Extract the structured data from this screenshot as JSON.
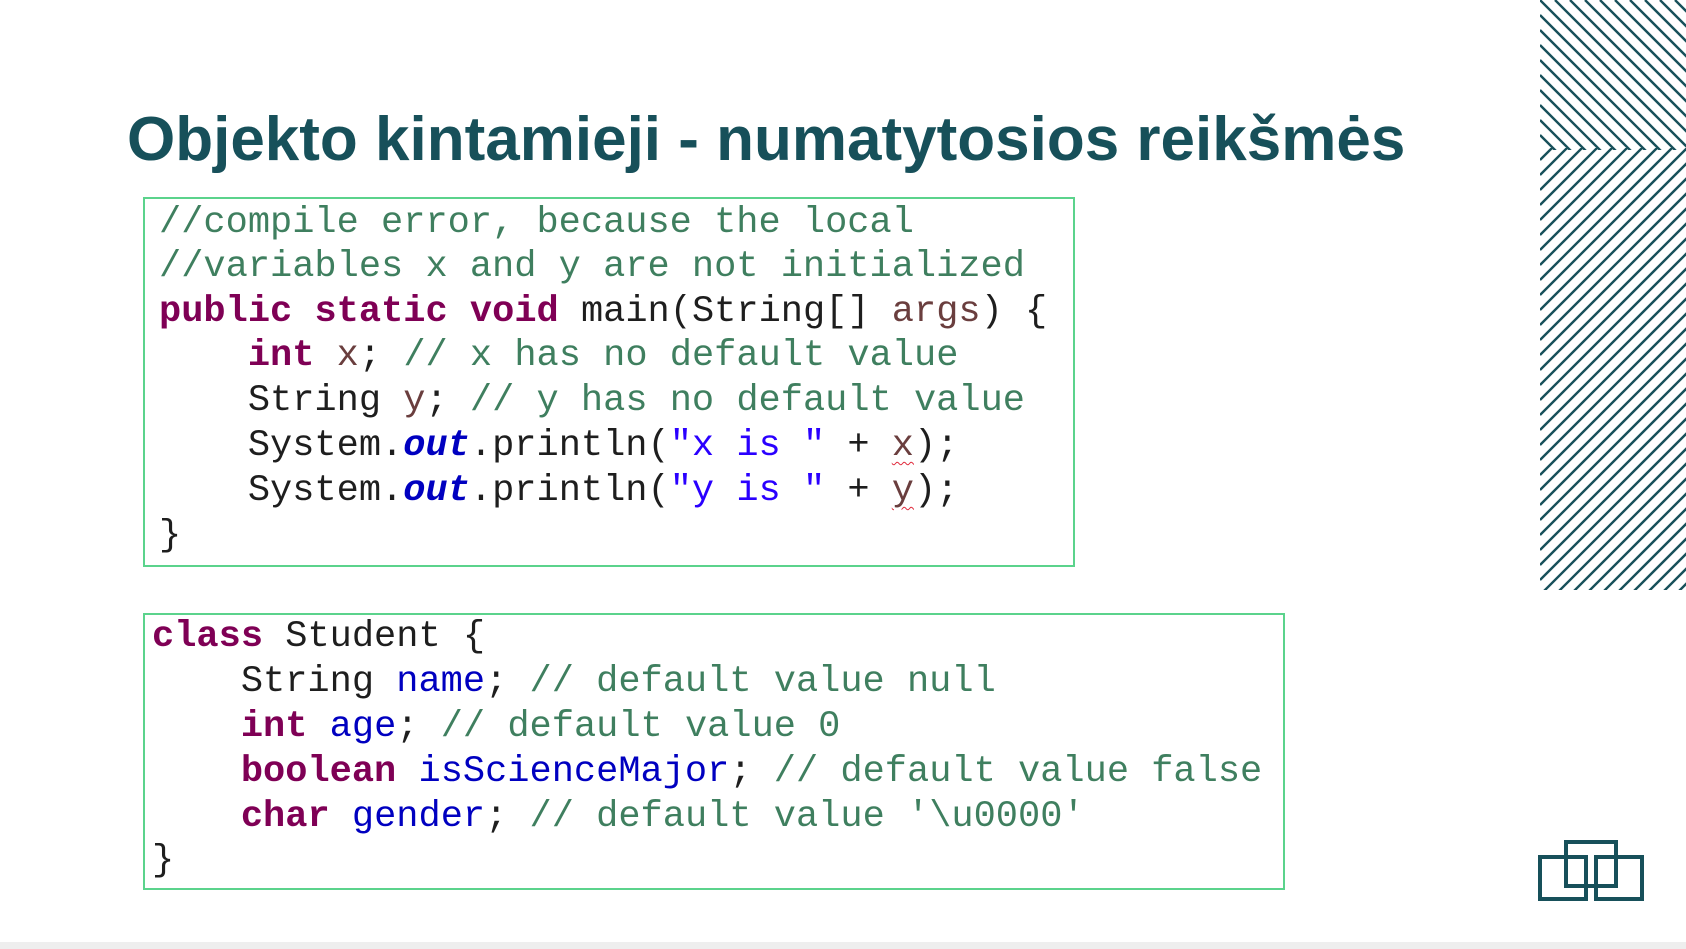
{
  "slide": {
    "title": "Objekto kintamieji - numatytosios reikšmės",
    "accent_color": "#17505a",
    "code_border_color": "#5bd38c"
  },
  "code_block_1": {
    "lines": [
      [
        {
          "t": "//compile error, because the local",
          "c": "cm"
        }
      ],
      [
        {
          "t": "//variables x and y are not initialized",
          "c": "cm"
        }
      ],
      [
        {
          "t": "public",
          "c": "kw"
        },
        {
          "t": " ",
          "c": "pln"
        },
        {
          "t": "static",
          "c": "kw"
        },
        {
          "t": " ",
          "c": "pln"
        },
        {
          "t": "void",
          "c": "kw"
        },
        {
          "t": " main(String[] ",
          "c": "pln"
        },
        {
          "t": "args",
          "c": "var"
        },
        {
          "t": ") {",
          "c": "pln"
        }
      ],
      [
        {
          "t": "    ",
          "c": "pln"
        },
        {
          "t": "int",
          "c": "kw"
        },
        {
          "t": " ",
          "c": "pln"
        },
        {
          "t": "x",
          "c": "var"
        },
        {
          "t": "; ",
          "c": "pln"
        },
        {
          "t": "// x has no default value",
          "c": "cm"
        }
      ],
      [
        {
          "t": "    String ",
          "c": "pln"
        },
        {
          "t": "y",
          "c": "var"
        },
        {
          "t": "; ",
          "c": "pln"
        },
        {
          "t": "// y has no default value",
          "c": "cm"
        }
      ],
      [
        {
          "t": "    System.",
          "c": "pln"
        },
        {
          "t": "out",
          "c": "stf"
        },
        {
          "t": ".println(",
          "c": "pln"
        },
        {
          "t": "\"x is \"",
          "c": "str"
        },
        {
          "t": " + ",
          "c": "pln"
        },
        {
          "t": "x",
          "c": "err"
        },
        {
          "t": ");",
          "c": "pln"
        }
      ],
      [
        {
          "t": "    System.",
          "c": "pln"
        },
        {
          "t": "out",
          "c": "stf"
        },
        {
          "t": ".println(",
          "c": "pln"
        },
        {
          "t": "\"y is \"",
          "c": "str"
        },
        {
          "t": " + ",
          "c": "pln"
        },
        {
          "t": "y",
          "c": "err"
        },
        {
          "t": ");",
          "c": "pln"
        }
      ],
      [
        {
          "t": "}",
          "c": "pln"
        }
      ]
    ]
  },
  "code_block_2": {
    "lines": [
      [
        {
          "t": "class",
          "c": "kw"
        },
        {
          "t": " Student {",
          "c": "pln"
        }
      ],
      [
        {
          "t": "    String ",
          "c": "pln"
        },
        {
          "t": "name",
          "c": "fld"
        },
        {
          "t": "; ",
          "c": "pln"
        },
        {
          "t": "// default value null",
          "c": "cm"
        }
      ],
      [
        {
          "t": "    ",
          "c": "pln"
        },
        {
          "t": "int",
          "c": "kw"
        },
        {
          "t": " ",
          "c": "pln"
        },
        {
          "t": "age",
          "c": "fld"
        },
        {
          "t": "; ",
          "c": "pln"
        },
        {
          "t": "// default value 0",
          "c": "cm"
        }
      ],
      [
        {
          "t": "    ",
          "c": "pln"
        },
        {
          "t": "boolean",
          "c": "kw"
        },
        {
          "t": " ",
          "c": "pln"
        },
        {
          "t": "isScienceMajor",
          "c": "fld"
        },
        {
          "t": "; ",
          "c": "pln"
        },
        {
          "t": "// default value false",
          "c": "cm"
        }
      ],
      [
        {
          "t": "    ",
          "c": "pln"
        },
        {
          "t": "char",
          "c": "kw"
        },
        {
          "t": " ",
          "c": "pln"
        },
        {
          "t": "gender",
          "c": "fld"
        },
        {
          "t": "; ",
          "c": "pln"
        },
        {
          "t": "// default value '\\u0000'",
          "c": "cm"
        }
      ],
      [
        {
          "t": "}",
          "c": "pln"
        }
      ]
    ]
  },
  "decorations": {
    "stripes_icon": "diagonal-stripes-pattern",
    "logo_icon": "interlocking-rectangles-logo"
  }
}
